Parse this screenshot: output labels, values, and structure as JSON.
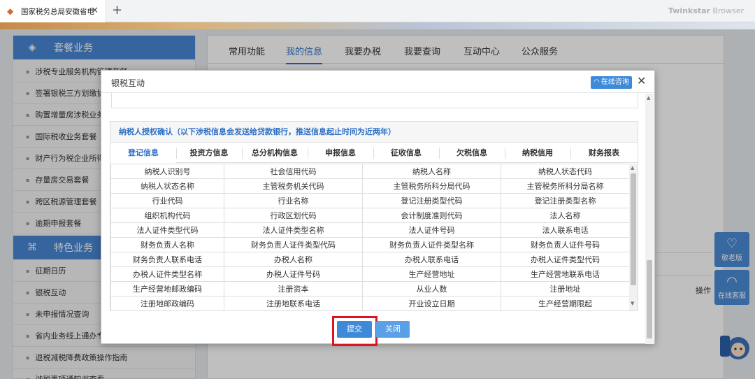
{
  "browser": {
    "tab_title": "国家税务总局安徽省电",
    "new_tab": "+",
    "brand_bold": "Twinkstar",
    "brand_light": " Browser"
  },
  "sidebar": {
    "section1": "套餐业务",
    "items1": [
      "涉税专业服务机构管理套餐",
      "签署银税三方划缴协议",
      "购置增量房涉税业务",
      "国际税收业务套餐",
      "财产行为税企业所得",
      "存量房交易套餐",
      "跨区税源管理套餐",
      "逾期申报套餐"
    ],
    "section2": "特色业务",
    "items2": [
      "征期日历",
      "银税互动",
      "未申报情况查询",
      "省内业务线上通办专",
      "退税减税降费政策操作指南",
      "涉税事项通知书查看"
    ]
  },
  "main": {
    "tabs": [
      "常用功能",
      "我的信息",
      "我要办税",
      "我要查询",
      "互动中心",
      "公众服务"
    ],
    "active_tab": 1,
    "op_label": "操作"
  },
  "floats": {
    "elder": "敬老版",
    "service": "在线客服"
  },
  "modal": {
    "title": "银税互动",
    "consult": "在线咨询",
    "auth_title": "纳税人授权确认（以下涉税信息会发送给贷款银行，推送信息起止时间为近两年）",
    "info_tabs": [
      "登记信息",
      "投资方信息",
      "总分机构信息",
      "申报信息",
      "征收信息",
      "欠税信息",
      "纳税信用",
      "财务报表"
    ],
    "active_info_tab": 0,
    "fields": [
      [
        "纳税人识别号",
        "社会信用代码",
        "纳税人名称",
        "纳税人状态代码"
      ],
      [
        "纳税人状态名称",
        "主管税务机关代码",
        "主管税务所科分局代码",
        "主管税务所科分局名称"
      ],
      [
        "行业代码",
        "行业名称",
        "登记注册类型代码",
        "登记注册类型名称"
      ],
      [
        "组织机构代码",
        "行政区划代码",
        "会计制度准则代码",
        "法人名称"
      ],
      [
        "法人证件类型代码",
        "法人证件类型名称",
        "法人证件号码",
        "法人联系电话"
      ],
      [
        "财务负责人名称",
        "财务负责人证件类型代码",
        "财务负责人证件类型名称",
        "财务负责人证件号码"
      ],
      [
        "财务负责人联系电话",
        "办税人名称",
        "办税人联系电话",
        "办税人证件类型代码"
      ],
      [
        "办税人证件类型名称",
        "办税人证件号码",
        "生产经营地址",
        "生产经营地联系电话"
      ],
      [
        "生产经营地邮政编码",
        "注册资本",
        "从业人数",
        "注册地址"
      ],
      [
        "注册地邮政编码",
        "注册地联系电话",
        "开业设立日期",
        "生产经营期限起"
      ]
    ],
    "submit": "提交",
    "close": "关闭"
  }
}
